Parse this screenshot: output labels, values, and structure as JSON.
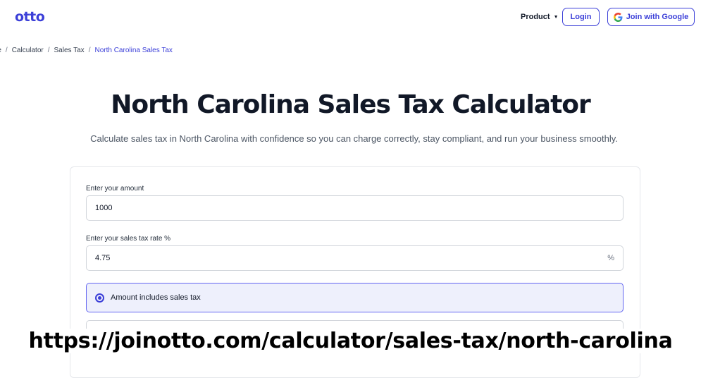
{
  "header": {
    "logo": "otto",
    "nav_product": "Product",
    "login_label": "Login",
    "google_label": "Join with Google",
    "brand_color": "#3b3fd8"
  },
  "breadcrumb": [
    "me",
    "Calculator",
    "Sales Tax",
    "North Carolina Sales Tax"
  ],
  "main": {
    "title": "North Carolina Sales Tax Calculator",
    "subtitle": "Calculate sales tax in North Carolina with confidence so you can charge correctly, stay compliant, and run your business smoothly."
  },
  "form": {
    "amount_label": "Enter your amount",
    "amount_value": "1000",
    "rate_label": "Enter your sales tax rate %",
    "rate_value": "4.75",
    "rate_suffix": "%",
    "option_includes": "Amount includes sales tax"
  },
  "url_caption": "https://joinotto.com/calculator/sales-tax/north-carolina"
}
